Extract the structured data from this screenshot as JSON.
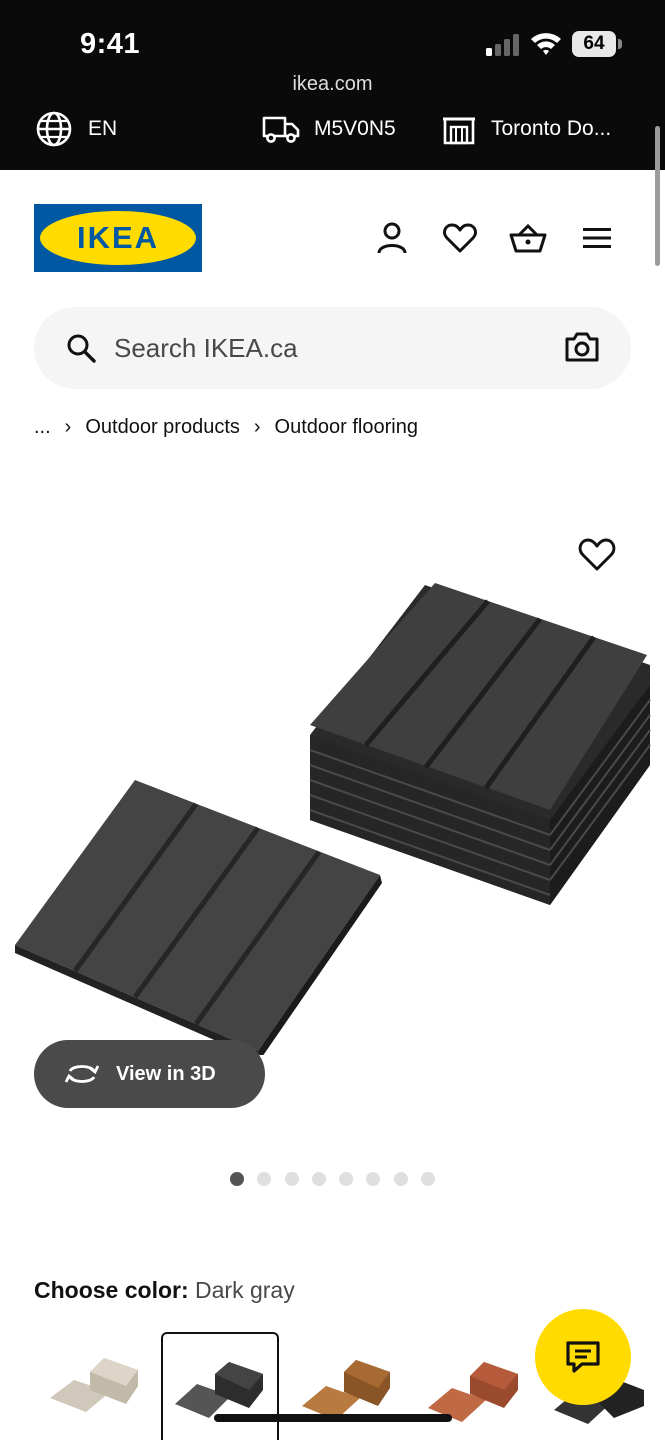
{
  "status_bar": {
    "time": "9:41",
    "battery": "64"
  },
  "browser": {
    "url": "ikea.com"
  },
  "locale_bar": {
    "language": "EN",
    "postal_code": "M5V0N5",
    "store": "Toronto Do..."
  },
  "header": {
    "logo_text": "IKEA"
  },
  "search": {
    "placeholder": "Search IKEA.ca"
  },
  "breadcrumb": {
    "ellipsis": "...",
    "items": [
      "Outdoor products",
      "Outdoor flooring"
    ]
  },
  "media": {
    "view3d_label": "View in 3D",
    "slide_count": 8,
    "active_slide": 1
  },
  "color_chooser": {
    "label": "Choose color:",
    "selected": "Dark gray",
    "swatches": [
      "beige",
      "dark-gray",
      "brown",
      "red-brown",
      "black"
    ]
  },
  "colors": {
    "ikea_blue": "#0058a3",
    "ikea_yellow": "#ffdb00",
    "topbar": "#0a0a0a"
  }
}
